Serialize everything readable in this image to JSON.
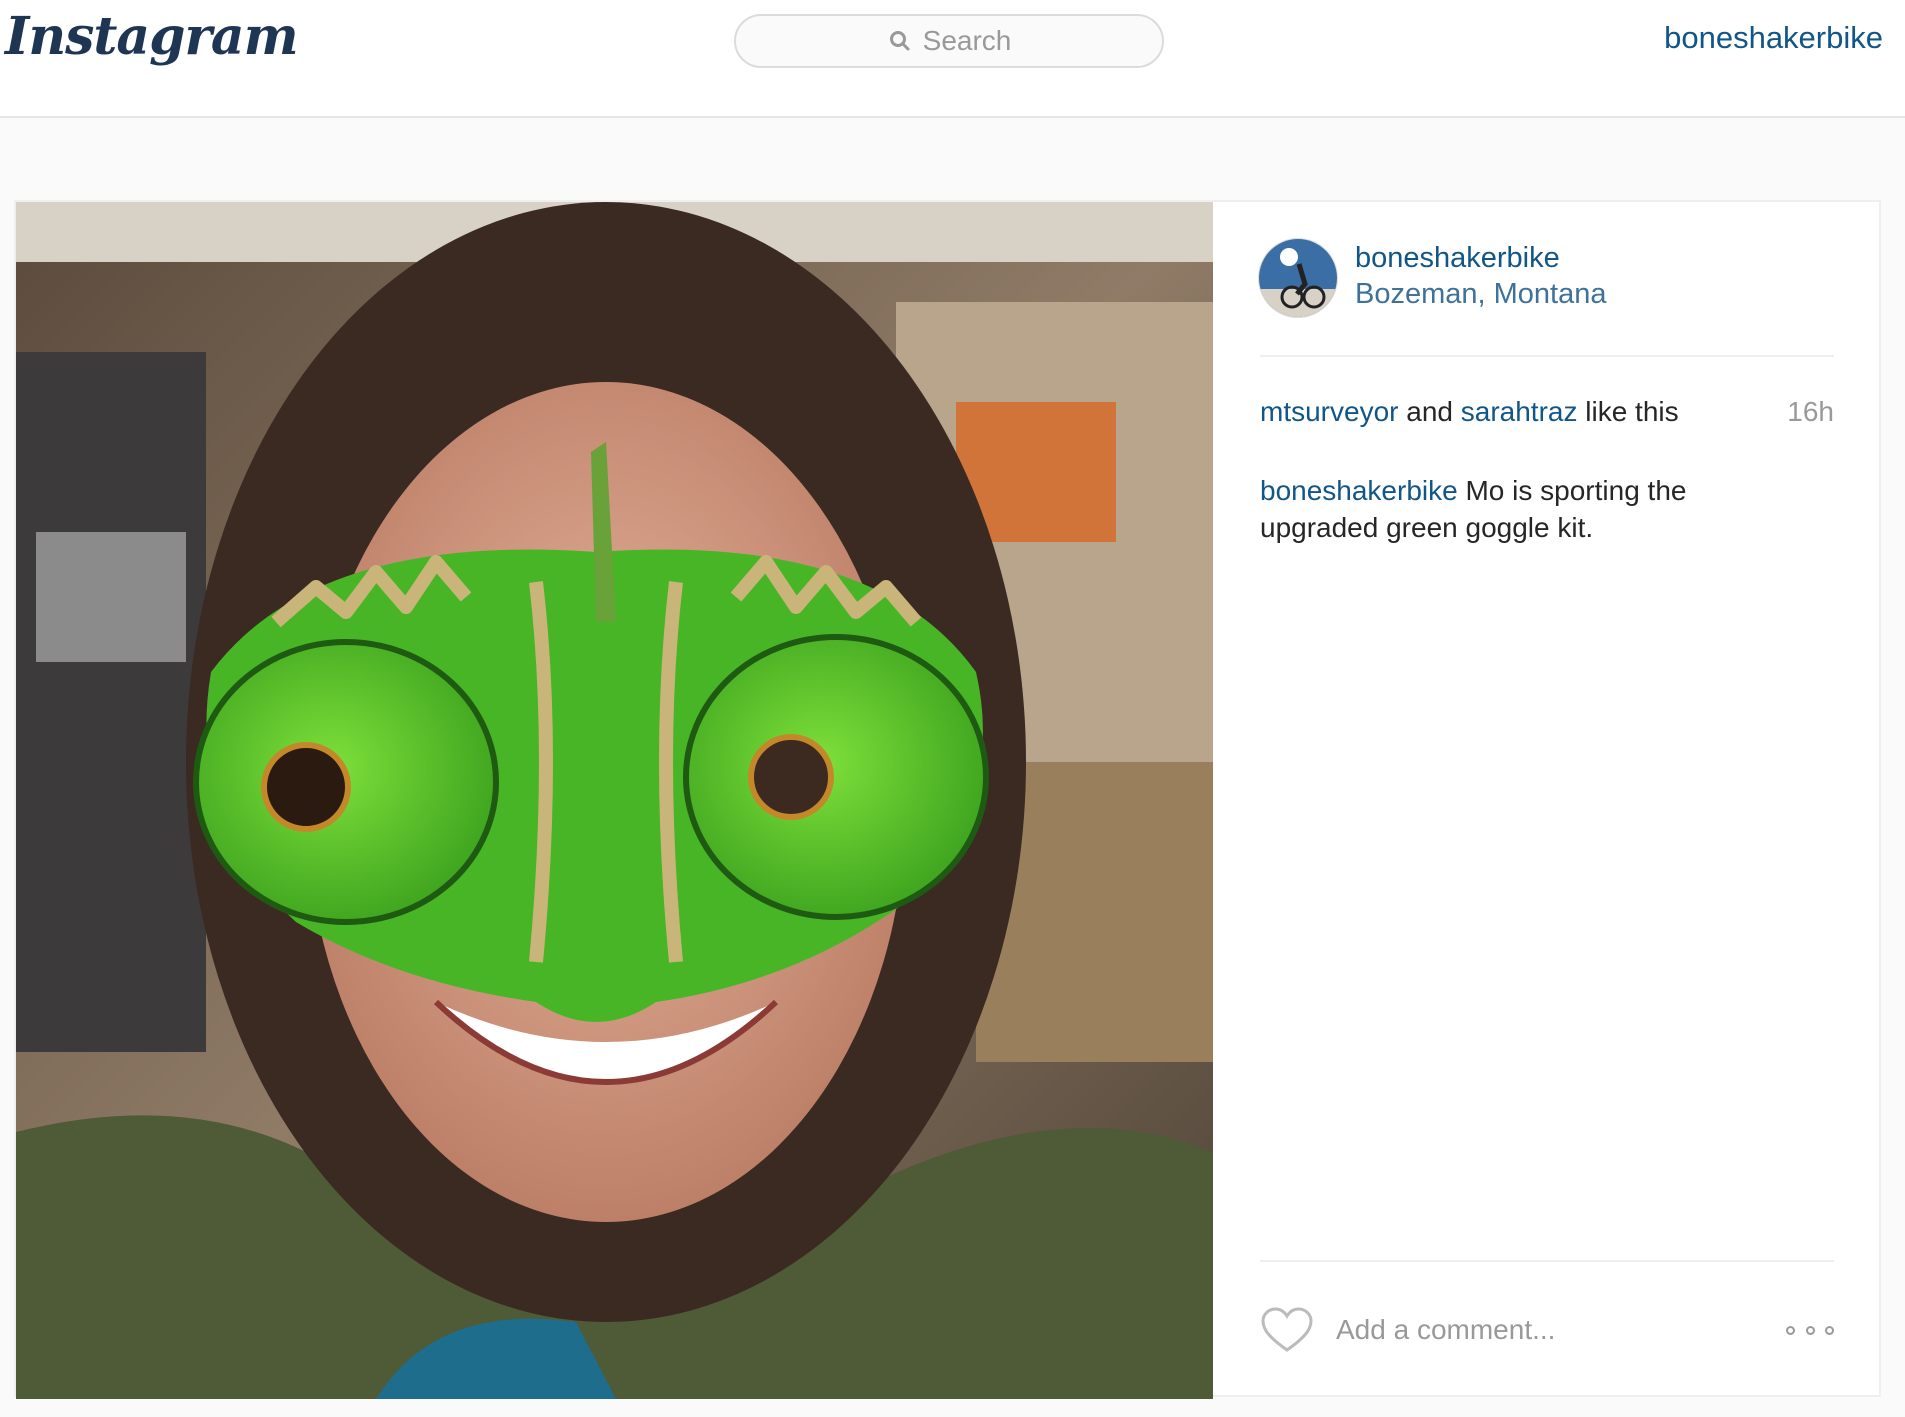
{
  "header": {
    "logo_text": "Instagram",
    "search_placeholder": "Search",
    "current_user": "boneshakerbike"
  },
  "post": {
    "owner": "boneshakerbike",
    "location": "Bozeman, Montana",
    "likes": {
      "user1": "mtsurveyor",
      "connector": " and ",
      "user2": "sarahtraz",
      "suffix": " like this"
    },
    "time_ago": "16h",
    "caption": {
      "user": "boneshakerbike",
      "text": " Mo is sporting the upgraded green goggle kit."
    },
    "comment_placeholder": "Add a comment..."
  },
  "colors": {
    "link_blue": "#125688",
    "location_blue": "#3f729b",
    "muted_gray": "#999999",
    "border": "#efefef"
  },
  "icons": [
    "search-icon",
    "heart-icon",
    "more-options-icon"
  ]
}
